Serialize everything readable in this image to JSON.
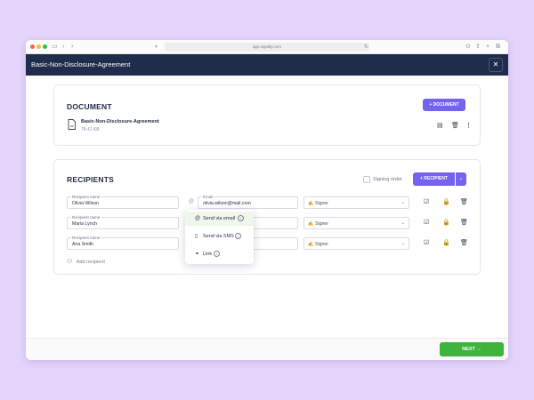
{
  "browser": {
    "url": "app.signitly.com",
    "colors": {
      "close": "#ff5f57",
      "minimize": "#febc2e",
      "maximize": "#28c840"
    }
  },
  "topbar": {
    "title": "Basic-Non-Disclosure-Agreement",
    "close_icon": "close-icon"
  },
  "document": {
    "section_title": "DOCUMENT",
    "add_button": "+ DOCUMENT",
    "file": {
      "name": "Basic-Non-Disclosure-Agreement",
      "size": "78.41 KB"
    }
  },
  "recipients": {
    "section_title": "RECIPIENTS",
    "signing_order_label": "Signing order",
    "add_button": "+ RECIPIENT",
    "name_label": "Recipient name",
    "email_label": "Email",
    "rows": [
      {
        "name": "Olivia Wilson",
        "email": "olivia.wilson@mail.com",
        "role": "Signer"
      },
      {
        "name": "Maria Lynch",
        "email": "",
        "role": "Signer"
      },
      {
        "name": "Ana Smith",
        "email": "",
        "role": "Signer"
      }
    ],
    "add_recipient_label": "Add recipient"
  },
  "dropdown": {
    "items": [
      {
        "label": "Send via email",
        "icon": "at-icon"
      },
      {
        "label": "Send via SMS",
        "icon": "phone-icon"
      },
      {
        "label": "Link",
        "icon": "link-icon"
      }
    ]
  },
  "footer": {
    "next_label": "NEXT →"
  },
  "colors": {
    "accent": "#7463ee",
    "navy": "#1f2c4c",
    "success": "#3fb43c"
  }
}
